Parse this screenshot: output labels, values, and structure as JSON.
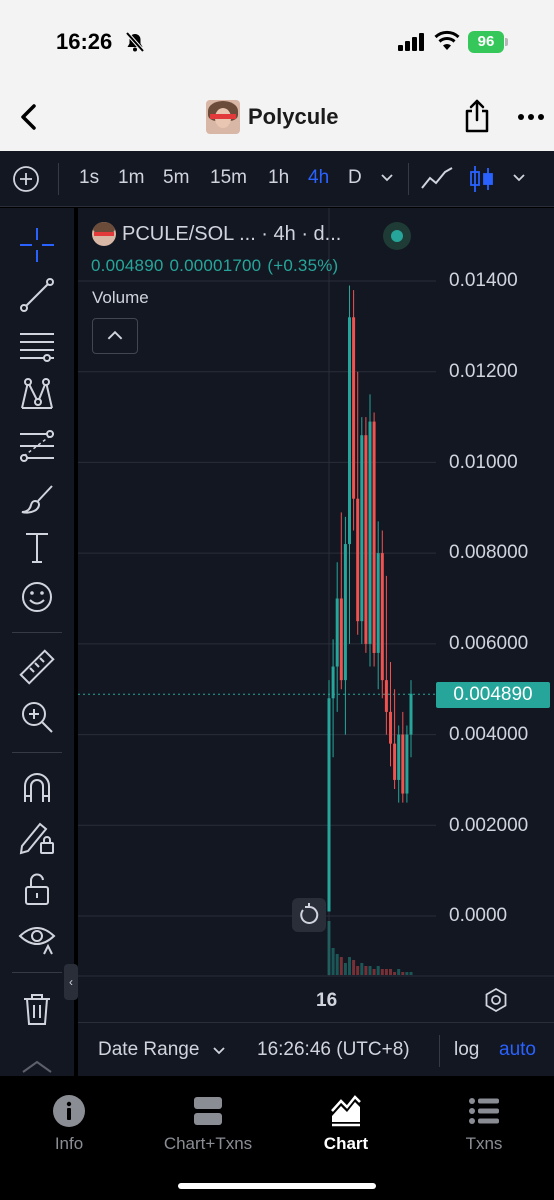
{
  "status_bar": {
    "time": "16:26",
    "battery": "96"
  },
  "nav": {
    "title": "Polycule"
  },
  "toolbar": {
    "intervals": [
      "1s",
      "1m",
      "5m",
      "15m",
      "1h",
      "4h",
      "D"
    ],
    "active_interval": "4h"
  },
  "sidebar": {
    "tools": [
      "crosshair",
      "trend-line",
      "horizontal-lines",
      "pattern",
      "fib-retracement",
      "brush",
      "text",
      "emoji",
      "ruler",
      "zoom-in",
      "magnet",
      "lock-drawing",
      "unlock",
      "eye",
      "trash"
    ]
  },
  "chart_header": {
    "symbol_title": "PCULE/SOL ... · 4h · d...",
    "last_price": "0.004890",
    "change": "0.00001700",
    "change_pct": "(+0.35%)",
    "volume_label": "Volume"
  },
  "chart_bottom": {
    "date_range": "Date Range",
    "clock": "16:26:46 (UTC+8)",
    "log": "log",
    "auto": "auto",
    "time_axis_label": "16"
  },
  "price_tag": "0.004890",
  "chart_data": {
    "type": "candlestick",
    "y_tick_labels": [
      "0.01400",
      "0.01200",
      "0.01000",
      "0.008000",
      "0.006000",
      "0.004000",
      "0.002000",
      "0.0000"
    ],
    "y_ticks": [
      0.014,
      0.012,
      0.01,
      0.008,
      0.006,
      0.004,
      0.002,
      0
    ],
    "ylim": [
      0,
      0.014
    ],
    "x_tick_labels": [
      "16"
    ],
    "last_price": 0.00489,
    "colors": {
      "up": "#26a69a",
      "down": "#ef5350"
    },
    "candles": [
      [
        0.0001,
        0.0052,
        0.0001,
        0.0048
      ],
      [
        0.0048,
        0.0061,
        0.0035,
        0.0055
      ],
      [
        0.0055,
        0.0078,
        0.0045,
        0.007
      ],
      [
        0.007,
        0.0089,
        0.005,
        0.0052
      ],
      [
        0.0052,
        0.0088,
        0.004,
        0.0082
      ],
      [
        0.0082,
        0.0139,
        0.006,
        0.0132
      ],
      [
        0.0132,
        0.0138,
        0.0085,
        0.0092
      ],
      [
        0.0092,
        0.012,
        0.0062,
        0.0065
      ],
      [
        0.0065,
        0.011,
        0.006,
        0.0106
      ],
      [
        0.0106,
        0.011,
        0.0058,
        0.006
      ],
      [
        0.006,
        0.0115,
        0.0055,
        0.0109
      ],
      [
        0.0109,
        0.0111,
        0.0055,
        0.0058
      ],
      [
        0.0058,
        0.0087,
        0.005,
        0.008
      ],
      [
        0.008,
        0.0085,
        0.0048,
        0.0052
      ],
      [
        0.0052,
        0.0075,
        0.004,
        0.0045
      ],
      [
        0.0045,
        0.0056,
        0.0033,
        0.0038
      ],
      [
        0.0038,
        0.005,
        0.0028,
        0.003
      ],
      [
        0.003,
        0.0042,
        0.0025,
        0.004
      ],
      [
        0.004,
        0.0045,
        0.0025,
        0.0027
      ],
      [
        0.0027,
        0.0042,
        0.0025,
        0.004
      ],
      [
        0.004,
        0.0052,
        0.0035,
        0.0049
      ]
    ],
    "volumes": [
      18,
      9,
      7,
      6,
      4,
      6,
      5,
      3,
      4,
      3,
      3,
      2,
      3,
      2,
      2,
      2,
      1,
      2,
      1,
      1,
      1
    ]
  },
  "tabs": [
    {
      "label": "Info",
      "icon": "info-icon"
    },
    {
      "label": "Chart+Txns",
      "icon": "split-icon"
    },
    {
      "label": "Chart",
      "icon": "chart-icon"
    },
    {
      "label": "Txns",
      "icon": "list-icon"
    }
  ],
  "active_tab": "Chart"
}
